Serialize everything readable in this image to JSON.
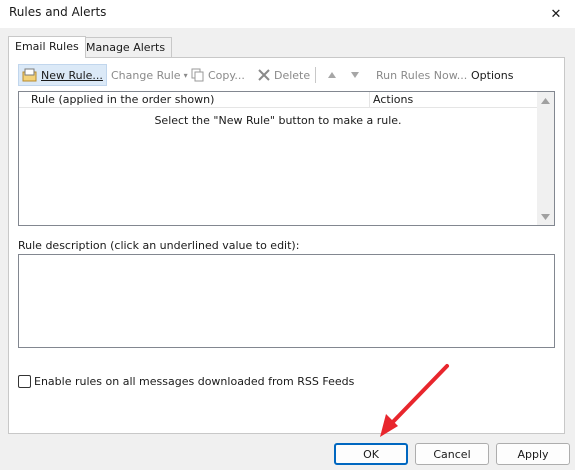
{
  "window": {
    "title": "Rules and Alerts",
    "close_glyph": "✕"
  },
  "tabs": [
    {
      "label": "Email Rules",
      "active": true
    },
    {
      "label": "Manage Alerts",
      "active": false
    }
  ],
  "toolbar": {
    "new_rule": "New Rule...",
    "change_rule": "Change Rule",
    "copy": "Copy...",
    "delete": "Delete",
    "run_rules_now": "Run Rules Now...",
    "options": "Options"
  },
  "rules_list": {
    "columns": [
      "Rule (applied in the order shown)",
      "Actions"
    ],
    "empty_message": "Select the \"New Rule\" button to make a rule."
  },
  "description": {
    "label": "Rule description (click an underlined value to edit):"
  },
  "rss": {
    "label": "Enable rules on all messages downloaded from RSS Feeds",
    "checked": false
  },
  "footer": {
    "ok": "OK",
    "cancel": "Cancel",
    "apply": "Apply"
  },
  "colors": {
    "accent": "#0067c0",
    "annotation_arrow": "#e8262d"
  }
}
